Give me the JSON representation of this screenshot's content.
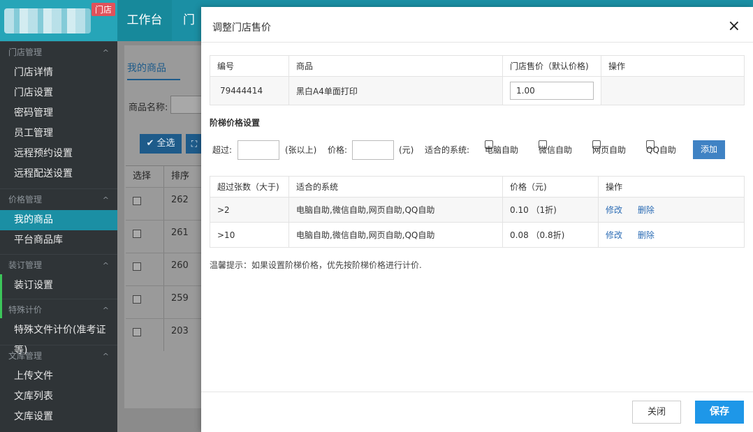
{
  "header": {
    "store_badge": "门店",
    "nav_items": [
      "工作台",
      "门"
    ]
  },
  "sidebar": {
    "groups": [
      {
        "title": "门店管理",
        "items": [
          "门店详情",
          "门店设置",
          "密码管理",
          "员工管理",
          "远程预约设置",
          "远程配送设置"
        ]
      },
      {
        "title": "价格管理",
        "items": [
          "我的商品",
          "平台商品库"
        ]
      },
      {
        "title": "装订管理",
        "items": [
          "装订设置"
        ]
      },
      {
        "title": "特殊计价",
        "items": [
          "特殊文件计价(准考证等)"
        ]
      },
      {
        "title": "文库管理",
        "items": [
          "上传文件",
          "文库列表",
          "文库设置"
        ]
      }
    ],
    "active_item": "我的商品"
  },
  "background": {
    "tab": "我的商品",
    "name_label": "商品名称:",
    "select_all": "全选",
    "columns": [
      "选择",
      "排序"
    ],
    "rows": [
      "262",
      "261",
      "260",
      "259",
      "203"
    ]
  },
  "modal": {
    "title": "调整门店售价",
    "close_icon": "×",
    "product_table": {
      "headers": [
        "编号",
        "商品",
        "门店售价（默认价格)",
        "操作"
      ],
      "row": {
        "id": "79444414",
        "name": "黑白A4单面打印",
        "price": "1.00"
      }
    },
    "tier_title": "阶梯价格设置",
    "form": {
      "exceed_label": "超过:",
      "sheets_suffix": "(张以上)",
      "price_label": "价格:",
      "yuan_suffix": "(元)",
      "systems_label": "适合的系统:",
      "systems": [
        "电脑自助",
        "微信自助",
        "网页自助",
        "QQ自助"
      ],
      "add_button": "添加"
    },
    "tier_table": {
      "headers": [
        "超过张数（大于)",
        "适合的系统",
        "价格（元)",
        "操作"
      ],
      "rows": [
        {
          "count": ">2",
          "systems": "电脑自助,微信自助,网页自助,QQ自助",
          "price": "0.10 （1折)",
          "edit": "修改",
          "delete": "删除"
        },
        {
          "count": ">10",
          "systems": "电脑自助,微信自助,网页自助,QQ自助",
          "price": "0.08 （0.8折)",
          "edit": "修改",
          "delete": "删除"
        }
      ]
    },
    "tip": "温馨提示：如果设置阶梯价格，优先按阶梯价格进行计价.",
    "close_button": "关闭",
    "save_button": "保存"
  }
}
